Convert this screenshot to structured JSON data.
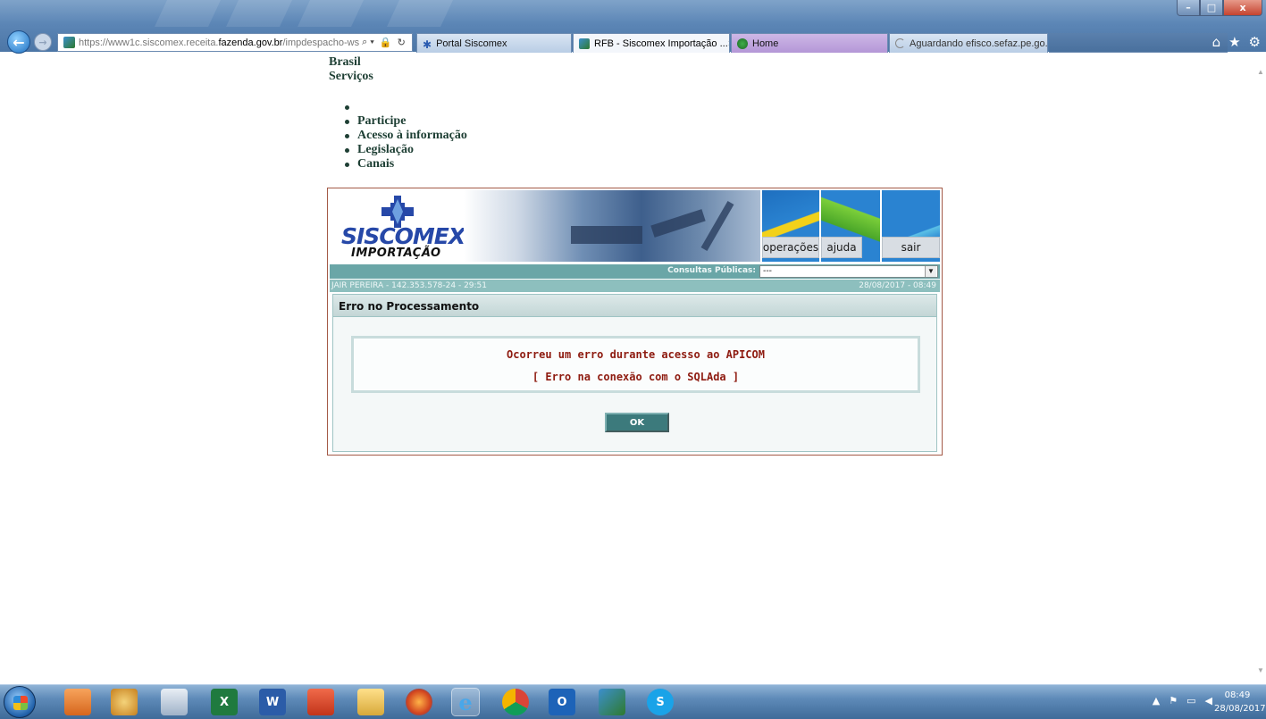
{
  "browser": {
    "url_prefix": "https://www1c.siscomex.receita.",
    "url_domain": "fazenda.gov.br",
    "url_suffix": "/impdespacho-ws",
    "search_glyph": "⌕ ▾",
    "lock_glyph": "🔒",
    "refresh_glyph": "↻",
    "tabs": [
      {
        "label": "Portal Siscomex"
      },
      {
        "label": "RFB - Siscomex Importação ...",
        "close": "×"
      },
      {
        "label": "Home"
      },
      {
        "label": "Aguardando efisco.sefaz.pe.go..."
      }
    ],
    "toolbar_icons": {
      "home": "⌂",
      "favorites": "★",
      "settings": "⚙"
    },
    "window_buttons": {
      "minimize": "–",
      "maximize": "□",
      "close": "x"
    },
    "back_glyph": "←",
    "forward_glyph": "→"
  },
  "gov_header": {
    "brasil": "Brasil",
    "servicos": "Serviços",
    "links": [
      "",
      "Participe",
      "Acesso à informação",
      "Legislação",
      "Canais"
    ]
  },
  "app": {
    "logo_line1": "SISCOMEX",
    "logo_line2": "IMPORTAÇÃO",
    "nav": {
      "operacoes": "operações",
      "ajuda": "ajuda",
      "sair": "sair"
    },
    "consultas_label": "Consultas Públicas:",
    "consultas_value": "---",
    "dropdown_arrow": "▼",
    "user_info": "JAIR PEREIRA - 142.353.578-24 - 29:51",
    "datetime": "28/08/2017 - 08:49",
    "panel_title": "Erro no Processamento",
    "error_line1": "Ocorreu um erro durante acesso ao APICOM",
    "error_line2": "[ Erro na conexão com o SQLAda ]",
    "ok_label": "OK"
  },
  "taskbar": {
    "icons": [
      "outlook-express",
      "paint",
      "calculator",
      "excel",
      "word",
      "cc",
      "file-explorer",
      "firefox",
      "internet-explorer",
      "chrome",
      "outlook",
      "siscomex",
      "skype"
    ],
    "excel_text": "X",
    "word_text": "W",
    "outlook_text": "O",
    "skype_text": "S",
    "tray_icons": {
      "show_hidden": "▲",
      "flag": "⚑",
      "network": "▭",
      "volume": "◀"
    },
    "clock_time": "08:49",
    "clock_date": "28/08/2017"
  },
  "colors": {
    "teal_bar": "#6aa6a7",
    "error_red": "#8e1b10",
    "frame_border": "#a35a47",
    "siscomex_blue": "#2648a8"
  }
}
